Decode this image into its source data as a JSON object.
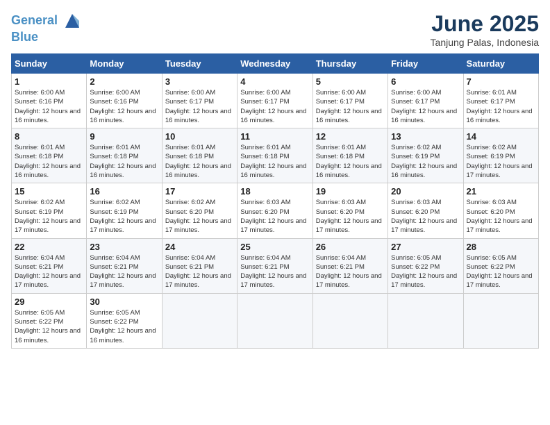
{
  "header": {
    "logo_line1": "General",
    "logo_line2": "Blue",
    "month": "June 2025",
    "location": "Tanjung Palas, Indonesia"
  },
  "columns": [
    "Sunday",
    "Monday",
    "Tuesday",
    "Wednesday",
    "Thursday",
    "Friday",
    "Saturday"
  ],
  "weeks": [
    [
      {
        "day": "1",
        "info": "Sunrise: 6:00 AM\nSunset: 6:16 PM\nDaylight: 12 hours and 16 minutes."
      },
      {
        "day": "2",
        "info": "Sunrise: 6:00 AM\nSunset: 6:16 PM\nDaylight: 12 hours and 16 minutes."
      },
      {
        "day": "3",
        "info": "Sunrise: 6:00 AM\nSunset: 6:17 PM\nDaylight: 12 hours and 16 minutes."
      },
      {
        "day": "4",
        "info": "Sunrise: 6:00 AM\nSunset: 6:17 PM\nDaylight: 12 hours and 16 minutes."
      },
      {
        "day": "5",
        "info": "Sunrise: 6:00 AM\nSunset: 6:17 PM\nDaylight: 12 hours and 16 minutes."
      },
      {
        "day": "6",
        "info": "Sunrise: 6:00 AM\nSunset: 6:17 PM\nDaylight: 12 hours and 16 minutes."
      },
      {
        "day": "7",
        "info": "Sunrise: 6:01 AM\nSunset: 6:17 PM\nDaylight: 12 hours and 16 minutes."
      }
    ],
    [
      {
        "day": "8",
        "info": "Sunrise: 6:01 AM\nSunset: 6:18 PM\nDaylight: 12 hours and 16 minutes."
      },
      {
        "day": "9",
        "info": "Sunrise: 6:01 AM\nSunset: 6:18 PM\nDaylight: 12 hours and 16 minutes."
      },
      {
        "day": "10",
        "info": "Sunrise: 6:01 AM\nSunset: 6:18 PM\nDaylight: 12 hours and 16 minutes."
      },
      {
        "day": "11",
        "info": "Sunrise: 6:01 AM\nSunset: 6:18 PM\nDaylight: 12 hours and 16 minutes."
      },
      {
        "day": "12",
        "info": "Sunrise: 6:01 AM\nSunset: 6:18 PM\nDaylight: 12 hours and 16 minutes."
      },
      {
        "day": "13",
        "info": "Sunrise: 6:02 AM\nSunset: 6:19 PM\nDaylight: 12 hours and 16 minutes."
      },
      {
        "day": "14",
        "info": "Sunrise: 6:02 AM\nSunset: 6:19 PM\nDaylight: 12 hours and 17 minutes."
      }
    ],
    [
      {
        "day": "15",
        "info": "Sunrise: 6:02 AM\nSunset: 6:19 PM\nDaylight: 12 hours and 17 minutes."
      },
      {
        "day": "16",
        "info": "Sunrise: 6:02 AM\nSunset: 6:19 PM\nDaylight: 12 hours and 17 minutes."
      },
      {
        "day": "17",
        "info": "Sunrise: 6:02 AM\nSunset: 6:20 PM\nDaylight: 12 hours and 17 minutes."
      },
      {
        "day": "18",
        "info": "Sunrise: 6:03 AM\nSunset: 6:20 PM\nDaylight: 12 hours and 17 minutes."
      },
      {
        "day": "19",
        "info": "Sunrise: 6:03 AM\nSunset: 6:20 PM\nDaylight: 12 hours and 17 minutes."
      },
      {
        "day": "20",
        "info": "Sunrise: 6:03 AM\nSunset: 6:20 PM\nDaylight: 12 hours and 17 minutes."
      },
      {
        "day": "21",
        "info": "Sunrise: 6:03 AM\nSunset: 6:20 PM\nDaylight: 12 hours and 17 minutes."
      }
    ],
    [
      {
        "day": "22",
        "info": "Sunrise: 6:04 AM\nSunset: 6:21 PM\nDaylight: 12 hours and 17 minutes."
      },
      {
        "day": "23",
        "info": "Sunrise: 6:04 AM\nSunset: 6:21 PM\nDaylight: 12 hours and 17 minutes."
      },
      {
        "day": "24",
        "info": "Sunrise: 6:04 AM\nSunset: 6:21 PM\nDaylight: 12 hours and 17 minutes."
      },
      {
        "day": "25",
        "info": "Sunrise: 6:04 AM\nSunset: 6:21 PM\nDaylight: 12 hours and 17 minutes."
      },
      {
        "day": "26",
        "info": "Sunrise: 6:04 AM\nSunset: 6:21 PM\nDaylight: 12 hours and 17 minutes."
      },
      {
        "day": "27",
        "info": "Sunrise: 6:05 AM\nSunset: 6:22 PM\nDaylight: 12 hours and 17 minutes."
      },
      {
        "day": "28",
        "info": "Sunrise: 6:05 AM\nSunset: 6:22 PM\nDaylight: 12 hours and 17 minutes."
      }
    ],
    [
      {
        "day": "29",
        "info": "Sunrise: 6:05 AM\nSunset: 6:22 PM\nDaylight: 12 hours and 16 minutes."
      },
      {
        "day": "30",
        "info": "Sunrise: 6:05 AM\nSunset: 6:22 PM\nDaylight: 12 hours and 16 minutes."
      },
      {
        "day": "",
        "info": ""
      },
      {
        "day": "",
        "info": ""
      },
      {
        "day": "",
        "info": ""
      },
      {
        "day": "",
        "info": ""
      },
      {
        "day": "",
        "info": ""
      }
    ]
  ]
}
